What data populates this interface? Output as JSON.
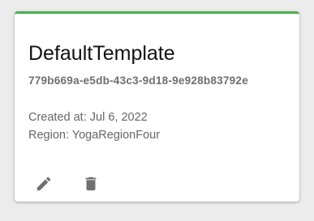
{
  "card": {
    "accent_color": "#4caf50",
    "title": "DefaultTemplate",
    "uuid": "779b669a-e5db-43c3-9d18-9e928b83792e",
    "created_label": "Created at:",
    "created_value": "Jul 6, 2022",
    "region_label": "Region:",
    "region_value": "YogaRegionFour",
    "actions": [
      {
        "icon": "pencil-icon"
      },
      {
        "icon": "trash-icon"
      }
    ]
  }
}
